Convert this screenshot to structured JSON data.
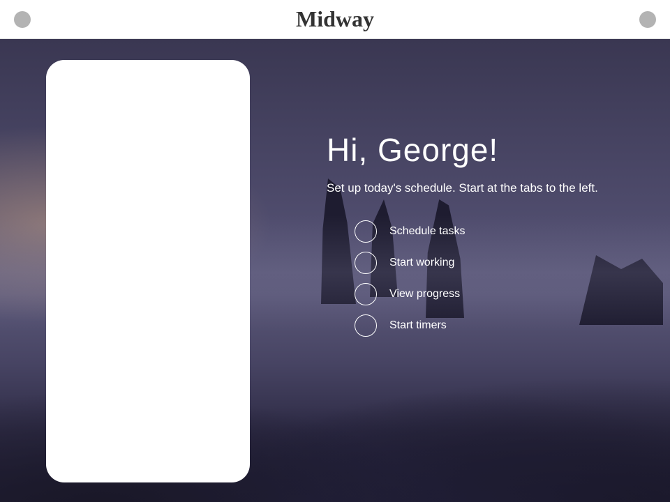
{
  "header": {
    "title": "Midway"
  },
  "greeting": {
    "title": "Hi, George!",
    "subtitle": "Set up today's schedule. Start at the tabs to the left."
  },
  "steps": [
    {
      "label": "Schedule tasks"
    },
    {
      "label": "Start working"
    },
    {
      "label": "View progress"
    },
    {
      "label": "Start timers"
    }
  ]
}
